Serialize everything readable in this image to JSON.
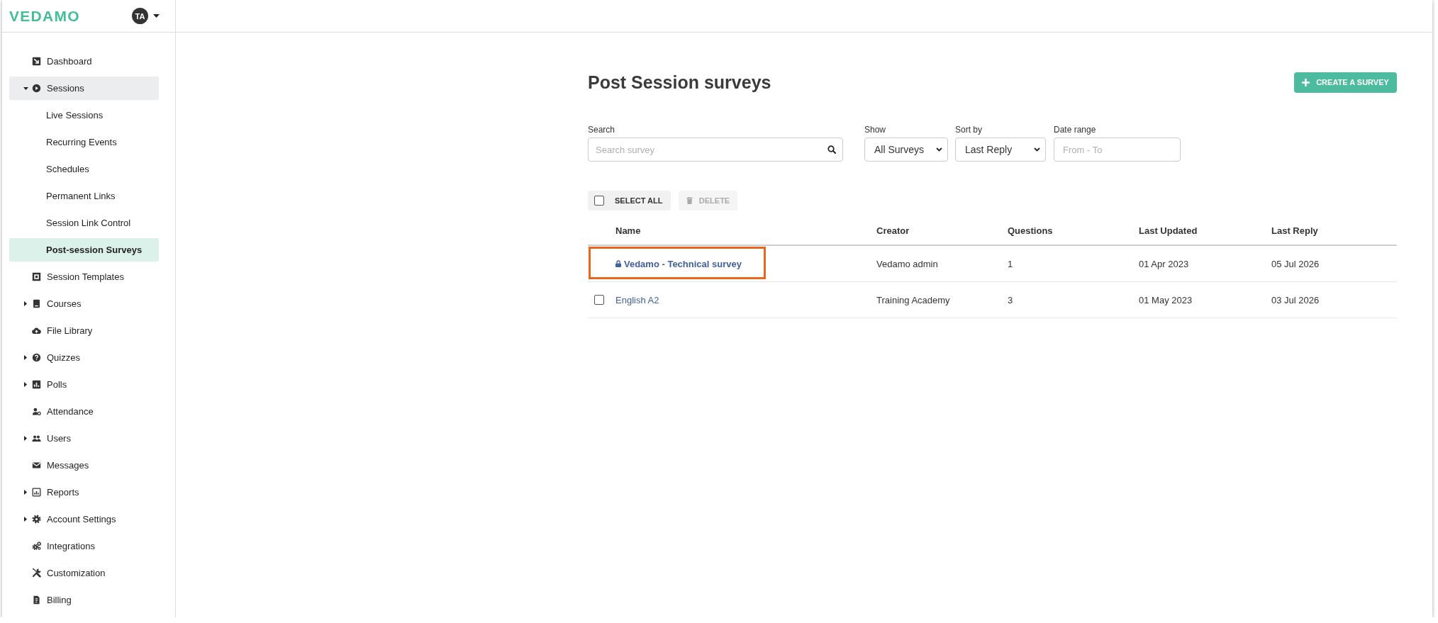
{
  "header": {
    "logo": "VEDAMO",
    "avatar": "TA"
  },
  "sidebar": {
    "items": [
      {
        "kind": "link",
        "label": "Dashboard",
        "selected": false
      },
      {
        "kind": "group",
        "label": "Sessions",
        "expanded": true,
        "selected": false,
        "children": [
          {
            "label": "Live Sessions",
            "selected": false
          },
          {
            "label": "Recurring Events",
            "selected": false
          },
          {
            "label": "Schedules",
            "selected": false
          },
          {
            "label": "Permanent Links",
            "selected": false
          },
          {
            "label": "Session Link Control",
            "selected": false
          },
          {
            "label": "Post-session Surveys",
            "selected": true
          }
        ]
      },
      {
        "kind": "link",
        "label": "Session Templates",
        "selected": false
      },
      {
        "kind": "group",
        "label": "Courses",
        "expanded": false,
        "selected": false
      },
      {
        "kind": "link",
        "label": "File Library",
        "selected": false
      },
      {
        "kind": "group",
        "label": "Quizzes",
        "expanded": false,
        "selected": false
      },
      {
        "kind": "group",
        "label": "Polls",
        "expanded": false,
        "selected": false
      },
      {
        "kind": "link",
        "label": "Attendance",
        "selected": false
      },
      {
        "kind": "group",
        "label": "Users",
        "expanded": false,
        "selected": false
      },
      {
        "kind": "link",
        "label": "Messages",
        "selected": false
      },
      {
        "kind": "group",
        "label": "Reports",
        "expanded": false,
        "selected": false
      },
      {
        "kind": "group",
        "label": "Account Settings",
        "expanded": false,
        "selected": false
      },
      {
        "kind": "link",
        "label": "Integrations",
        "selected": false
      },
      {
        "kind": "link",
        "label": "Customization",
        "selected": false
      },
      {
        "kind": "link",
        "label": "Billing",
        "selected": false
      }
    ]
  },
  "page": {
    "title": "Post Session surveys",
    "create_button": "CREATE A SURVEY"
  },
  "filters": {
    "search": {
      "label": "Search",
      "placeholder": "Search survey"
    },
    "show": {
      "label": "Show",
      "value": "All Surveys"
    },
    "sort_by": {
      "label": "Sort by",
      "value": "Last Reply"
    },
    "date_range": {
      "label": "Date range",
      "placeholder": "From - To"
    }
  },
  "bulk_actions": {
    "select_all": {
      "label": "SELECT ALL",
      "checked": false
    },
    "delete": {
      "label": "DELETE",
      "disabled": true
    }
  },
  "table": {
    "columns": [
      "Name",
      "Creator",
      "Questions",
      "Last Updated",
      "Last Reply"
    ],
    "rows": [
      {
        "name": "Vedamo - Technical survey",
        "creator": "Vedamo admin",
        "questions": "1",
        "last_updated": "01 Apr 2023",
        "last_reply": "05 Jul 2026",
        "locked": true,
        "highlighted": true
      },
      {
        "name": "English A2",
        "creator": "Training Academy",
        "questions": "3",
        "last_updated": "01 May 2023",
        "last_reply": "03 Jul 2026",
        "locked": false,
        "checked": false,
        "highlighted": false
      }
    ]
  }
}
